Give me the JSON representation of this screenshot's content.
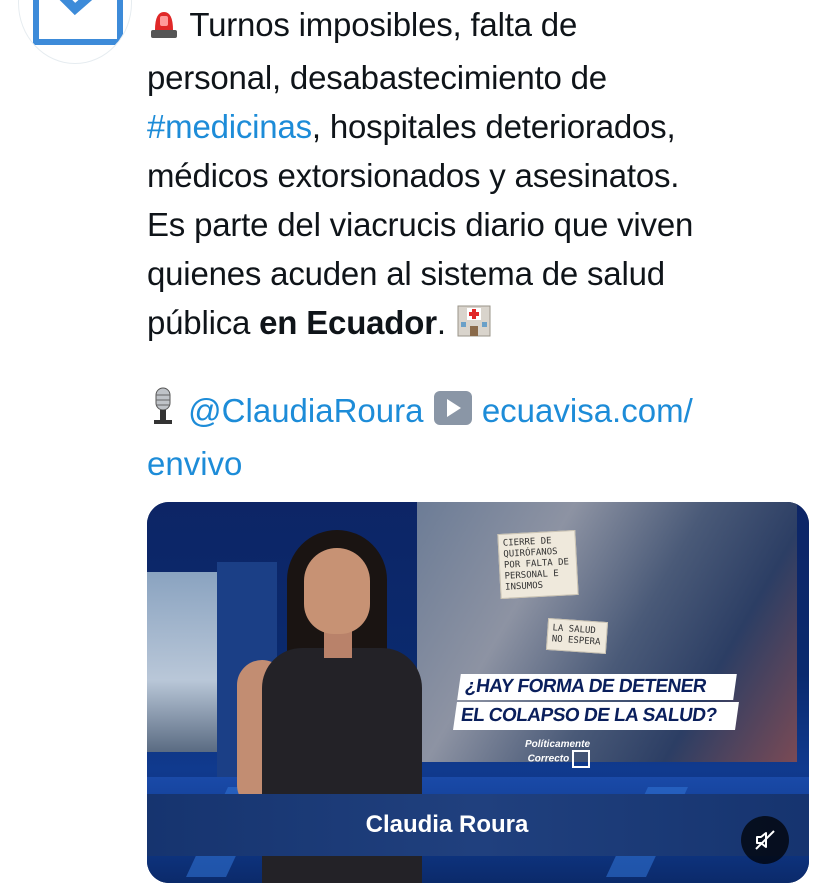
{
  "tweet": {
    "line1": "Turnos imposibles, falta de",
    "line2": "personal, desabastecimiento de",
    "hashtag": "#medicinas",
    "line3_rest": ", hospitales deteriorados,",
    "line4": "médicos extorsionados y asesinatos.",
    "line5": "Es parte del viacrucis diario que viven",
    "line6": "quienes acuden al sistema de salud",
    "line7_start": "pública ",
    "line7_bold": "en Ecuador",
    "line7_end": ".",
    "emoji_start": "police-light-emoji",
    "emoji_end": "hospital-emoji"
  },
  "credit": {
    "mic_emoji": "microphone-emoji",
    "mention": "@ClaudiaRoura",
    "play_emoji": "play-button-emoji",
    "link_part1": "ecuavisa.com/",
    "link_part2": "envivo"
  },
  "video": {
    "headline_line1": "¿HAY FORMA DE DETENER",
    "headline_line2": "EL COLAPSO DE LA SALUD?",
    "brand_line1": "Políticamente",
    "brand_line2": "Correcto",
    "poster1": "CIERRE DE QUIRÓFANOS POR FALTA DE PERSONAL E INSUMOS",
    "poster2": "LA SALUD NO ESPERA",
    "presenter_name": "Claudia Roura",
    "mute_icon": "muted-speaker-icon"
  },
  "colors": {
    "link": "#1d8cd8",
    "avatar_check": "#3d8bd9",
    "lower_third": "#20407e"
  }
}
